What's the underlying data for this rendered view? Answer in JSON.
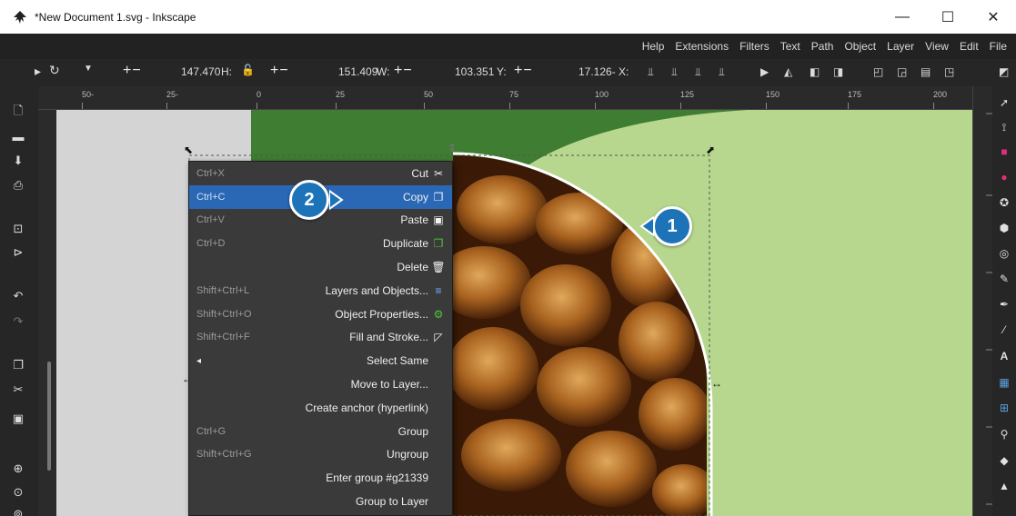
{
  "window": {
    "title": "*New Document 1.svg - Inkscape",
    "minimize": "—",
    "maximize": "☐",
    "close": "✕"
  },
  "menubar": [
    "Help",
    "Extensions",
    "Filters",
    "Text",
    "Path",
    "Object",
    "Layer",
    "View",
    "Edit",
    "File"
  ],
  "controls": {
    "h_label": "H:",
    "h_value": "147.470",
    "w_label": "W:",
    "w_value": "151.409",
    "y_label": "Y:",
    "y_value": "103.351",
    "x_label": "X:",
    "x_value": "17.126-",
    "plusminus": "+−"
  },
  "ruler": {
    "ticks": [
      "50-",
      "25-",
      "0",
      "25",
      "50",
      "75",
      "100",
      "125",
      "150",
      "175",
      "200"
    ]
  },
  "context_menu": {
    "items": [
      {
        "shortcut": "Ctrl+X",
        "label": "Cut",
        "icon": "scissors-icon",
        "glyph": "✂"
      },
      {
        "shortcut": "Ctrl+C",
        "label": "Copy",
        "icon": "copy-icon",
        "glyph": "❐"
      },
      {
        "shortcut": "Ctrl+V",
        "label": "Paste",
        "icon": "paste-icon",
        "glyph": "▣"
      },
      {
        "shortcut": "Ctrl+D",
        "label": "Duplicate",
        "icon": "duplicate-icon",
        "glyph": "❐"
      },
      {
        "shortcut": "",
        "label": "Delete",
        "icon": "trash-icon",
        "glyph": "🗑"
      },
      {
        "shortcut": "Shift+Ctrl+L",
        "label": "Layers and Objects...",
        "icon": "layers-icon",
        "glyph": "≡"
      },
      {
        "shortcut": "Shift+Ctrl+O",
        "label": "Object Properties...",
        "icon": "object-properties-icon",
        "glyph": "⚙"
      },
      {
        "shortcut": "Shift+Ctrl+F",
        "label": "Fill and Stroke...",
        "icon": "fill-stroke-icon",
        "glyph": "◸"
      },
      {
        "shortcut": "",
        "label": "Select Same",
        "icon": "submenu-arrow-icon",
        "glyph": "◂"
      },
      {
        "shortcut": "",
        "label": "Move to Layer...",
        "icon": "",
        "glyph": ""
      },
      {
        "shortcut": "",
        "label": "Create anchor (hyperlink)",
        "icon": "",
        "glyph": ""
      },
      {
        "shortcut": "Ctrl+G",
        "label": "Group",
        "icon": "",
        "glyph": ""
      },
      {
        "shortcut": "Shift+Ctrl+G",
        "label": "Ungroup",
        "icon": "",
        "glyph": ""
      },
      {
        "shortcut": "",
        "label": "Enter group #g21339",
        "icon": "",
        "glyph": ""
      },
      {
        "shortcut": "",
        "label": "Group to Layer",
        "icon": "",
        "glyph": ""
      }
    ],
    "highlighted_index": 1
  },
  "badges": {
    "one": "1",
    "two": "2"
  },
  "colors": {
    "accent_blue": "#1d73b8",
    "highlight_blue": "#2a67b4",
    "dark_green": "#3e7d32",
    "light_green": "#b7d78f",
    "menu_bg": "#3a3a3a"
  }
}
